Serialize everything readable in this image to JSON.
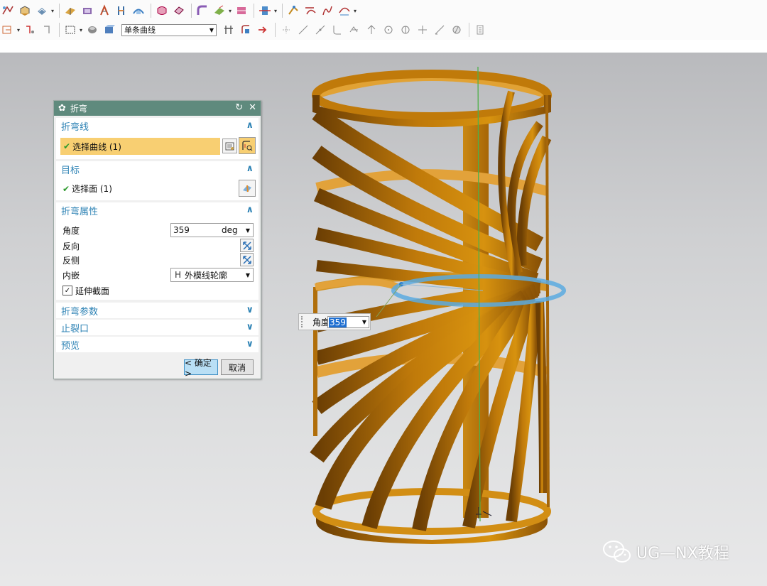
{
  "toolbar": {
    "row1_icons": [
      "sketch-icon",
      "extrude-icon",
      "revolve-icon",
      "hole-icon",
      "blend-icon",
      "chamfer-icon",
      "shell-icon",
      "draft-icon",
      "sweep-icon",
      "pattern-icon",
      "unite-icon",
      "sheet-icon",
      "bend-icon",
      "offset-icon",
      "trim-icon",
      "move-face-icon",
      "measure-icon",
      "curve-icon",
      "spline-icon",
      "arc-icon"
    ],
    "curve_rule": "单条曲线"
  },
  "dialog": {
    "title": "折弯",
    "bend_line": {
      "header": "折弯线",
      "select_curve": "选择曲线 (1)"
    },
    "target": {
      "header": "目标",
      "select_face": "选择面 (1)"
    },
    "bend_props": {
      "header": "折弯属性",
      "angle_label": "角度",
      "angle_value": "359",
      "angle_unit": "deg",
      "reverse_label": "反向",
      "reverse_side_label": "反侧",
      "inset_label": "内嵌",
      "inset_value": "外模线轮廓",
      "inset_prefix": "H",
      "extend_label": "延伸截面",
      "extend_checked": true
    },
    "collapsed": [
      {
        "label": "折弯参数"
      },
      {
        "label": "止裂口"
      },
      {
        "label": "预览"
      }
    ],
    "ok_label": "< 确定 >",
    "cancel_label": "取消"
  },
  "angle_popup": {
    "label": "角度",
    "value": "359"
  },
  "watermark": "UG—NX教程",
  "colors": {
    "title_bar": "#5f8a7d",
    "section_header": "#2e83b5",
    "selected_row": "#f8cf72",
    "model": "#c07a0a",
    "ok_button": "#b9dff5"
  }
}
